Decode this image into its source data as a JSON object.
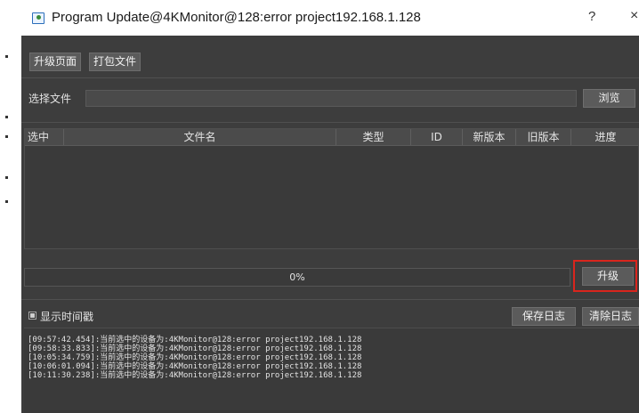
{
  "window": {
    "title": "Program Update@4KMonitor@128:error project192.168.1.128",
    "help_label": "?",
    "close_label": "×"
  },
  "tabs": [
    {
      "label": "升级页面"
    },
    {
      "label": "打包文件"
    }
  ],
  "file_select": {
    "label": "选择文件",
    "value": "",
    "browse_label": "浏览"
  },
  "table": {
    "columns": [
      "选中",
      "文件名",
      "类型",
      "ID",
      "新版本",
      "旧版本",
      "进度"
    ],
    "rows": []
  },
  "progress": {
    "value": 0,
    "text": "0%"
  },
  "upgrade_label": "升级",
  "options": {
    "show_timestamp_label": "显示时间戳",
    "show_timestamp_checked": true
  },
  "log_buttons": {
    "save_label": "保存日志",
    "clear_label": "清除日志"
  },
  "log": {
    "lines": [
      "[09:57:42.454]:当前选中的设备为:4KMonitor@128:error project192.168.1.128",
      "[09:58:33.833]:当前选中的设备为:4KMonitor@128:error project192.168.1.128",
      "[10:05:34.759]:当前选中的设备为:4KMonitor@128:error project192.168.1.128",
      "[10:06:01.094]:当前选中的设备为:4KMonitor@128:error project192.168.1.128",
      "[10:11:30.238]:当前选中的设备为:4KMonitor@128:error project192.168.1.128"
    ]
  },
  "colors": {
    "background": "#3d3d3d",
    "highlight": "#d9251d"
  }
}
